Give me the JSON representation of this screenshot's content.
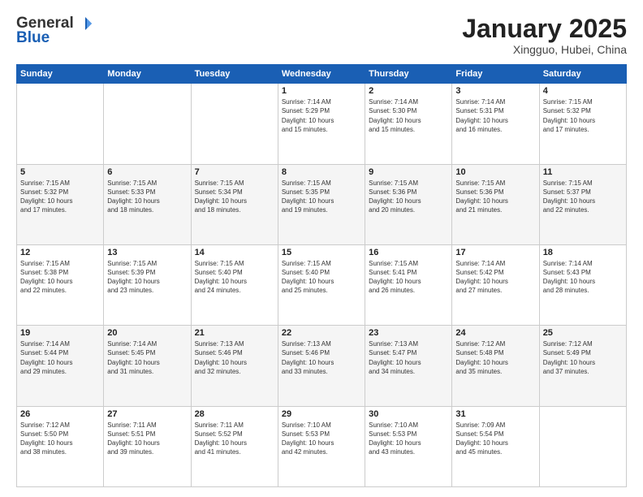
{
  "header": {
    "logo": {
      "general": "General",
      "blue": "Blue",
      "tagline": "General Blue"
    },
    "title": "January 2025",
    "subtitle": "Xingguo, Hubei, China"
  },
  "days_of_week": [
    "Sunday",
    "Monday",
    "Tuesday",
    "Wednesday",
    "Thursday",
    "Friday",
    "Saturday"
  ],
  "weeks": [
    [
      {
        "day": "",
        "info": ""
      },
      {
        "day": "",
        "info": ""
      },
      {
        "day": "",
        "info": ""
      },
      {
        "day": "1",
        "info": "Sunrise: 7:14 AM\nSunset: 5:29 PM\nDaylight: 10 hours\nand 15 minutes."
      },
      {
        "day": "2",
        "info": "Sunrise: 7:14 AM\nSunset: 5:30 PM\nDaylight: 10 hours\nand 15 minutes."
      },
      {
        "day": "3",
        "info": "Sunrise: 7:14 AM\nSunset: 5:31 PM\nDaylight: 10 hours\nand 16 minutes."
      },
      {
        "day": "4",
        "info": "Sunrise: 7:15 AM\nSunset: 5:32 PM\nDaylight: 10 hours\nand 17 minutes."
      }
    ],
    [
      {
        "day": "5",
        "info": "Sunrise: 7:15 AM\nSunset: 5:32 PM\nDaylight: 10 hours\nand 17 minutes."
      },
      {
        "day": "6",
        "info": "Sunrise: 7:15 AM\nSunset: 5:33 PM\nDaylight: 10 hours\nand 18 minutes."
      },
      {
        "day": "7",
        "info": "Sunrise: 7:15 AM\nSunset: 5:34 PM\nDaylight: 10 hours\nand 18 minutes."
      },
      {
        "day": "8",
        "info": "Sunrise: 7:15 AM\nSunset: 5:35 PM\nDaylight: 10 hours\nand 19 minutes."
      },
      {
        "day": "9",
        "info": "Sunrise: 7:15 AM\nSunset: 5:36 PM\nDaylight: 10 hours\nand 20 minutes."
      },
      {
        "day": "10",
        "info": "Sunrise: 7:15 AM\nSunset: 5:36 PM\nDaylight: 10 hours\nand 21 minutes."
      },
      {
        "day": "11",
        "info": "Sunrise: 7:15 AM\nSunset: 5:37 PM\nDaylight: 10 hours\nand 22 minutes."
      }
    ],
    [
      {
        "day": "12",
        "info": "Sunrise: 7:15 AM\nSunset: 5:38 PM\nDaylight: 10 hours\nand 22 minutes."
      },
      {
        "day": "13",
        "info": "Sunrise: 7:15 AM\nSunset: 5:39 PM\nDaylight: 10 hours\nand 23 minutes."
      },
      {
        "day": "14",
        "info": "Sunrise: 7:15 AM\nSunset: 5:40 PM\nDaylight: 10 hours\nand 24 minutes."
      },
      {
        "day": "15",
        "info": "Sunrise: 7:15 AM\nSunset: 5:40 PM\nDaylight: 10 hours\nand 25 minutes."
      },
      {
        "day": "16",
        "info": "Sunrise: 7:15 AM\nSunset: 5:41 PM\nDaylight: 10 hours\nand 26 minutes."
      },
      {
        "day": "17",
        "info": "Sunrise: 7:14 AM\nSunset: 5:42 PM\nDaylight: 10 hours\nand 27 minutes."
      },
      {
        "day": "18",
        "info": "Sunrise: 7:14 AM\nSunset: 5:43 PM\nDaylight: 10 hours\nand 28 minutes."
      }
    ],
    [
      {
        "day": "19",
        "info": "Sunrise: 7:14 AM\nSunset: 5:44 PM\nDaylight: 10 hours\nand 29 minutes."
      },
      {
        "day": "20",
        "info": "Sunrise: 7:14 AM\nSunset: 5:45 PM\nDaylight: 10 hours\nand 31 minutes."
      },
      {
        "day": "21",
        "info": "Sunrise: 7:13 AM\nSunset: 5:46 PM\nDaylight: 10 hours\nand 32 minutes."
      },
      {
        "day": "22",
        "info": "Sunrise: 7:13 AM\nSunset: 5:46 PM\nDaylight: 10 hours\nand 33 minutes."
      },
      {
        "day": "23",
        "info": "Sunrise: 7:13 AM\nSunset: 5:47 PM\nDaylight: 10 hours\nand 34 minutes."
      },
      {
        "day": "24",
        "info": "Sunrise: 7:12 AM\nSunset: 5:48 PM\nDaylight: 10 hours\nand 35 minutes."
      },
      {
        "day": "25",
        "info": "Sunrise: 7:12 AM\nSunset: 5:49 PM\nDaylight: 10 hours\nand 37 minutes."
      }
    ],
    [
      {
        "day": "26",
        "info": "Sunrise: 7:12 AM\nSunset: 5:50 PM\nDaylight: 10 hours\nand 38 minutes."
      },
      {
        "day": "27",
        "info": "Sunrise: 7:11 AM\nSunset: 5:51 PM\nDaylight: 10 hours\nand 39 minutes."
      },
      {
        "day": "28",
        "info": "Sunrise: 7:11 AM\nSunset: 5:52 PM\nDaylight: 10 hours\nand 41 minutes."
      },
      {
        "day": "29",
        "info": "Sunrise: 7:10 AM\nSunset: 5:53 PM\nDaylight: 10 hours\nand 42 minutes."
      },
      {
        "day": "30",
        "info": "Sunrise: 7:10 AM\nSunset: 5:53 PM\nDaylight: 10 hours\nand 43 minutes."
      },
      {
        "day": "31",
        "info": "Sunrise: 7:09 AM\nSunset: 5:54 PM\nDaylight: 10 hours\nand 45 minutes."
      },
      {
        "day": "",
        "info": ""
      }
    ]
  ]
}
